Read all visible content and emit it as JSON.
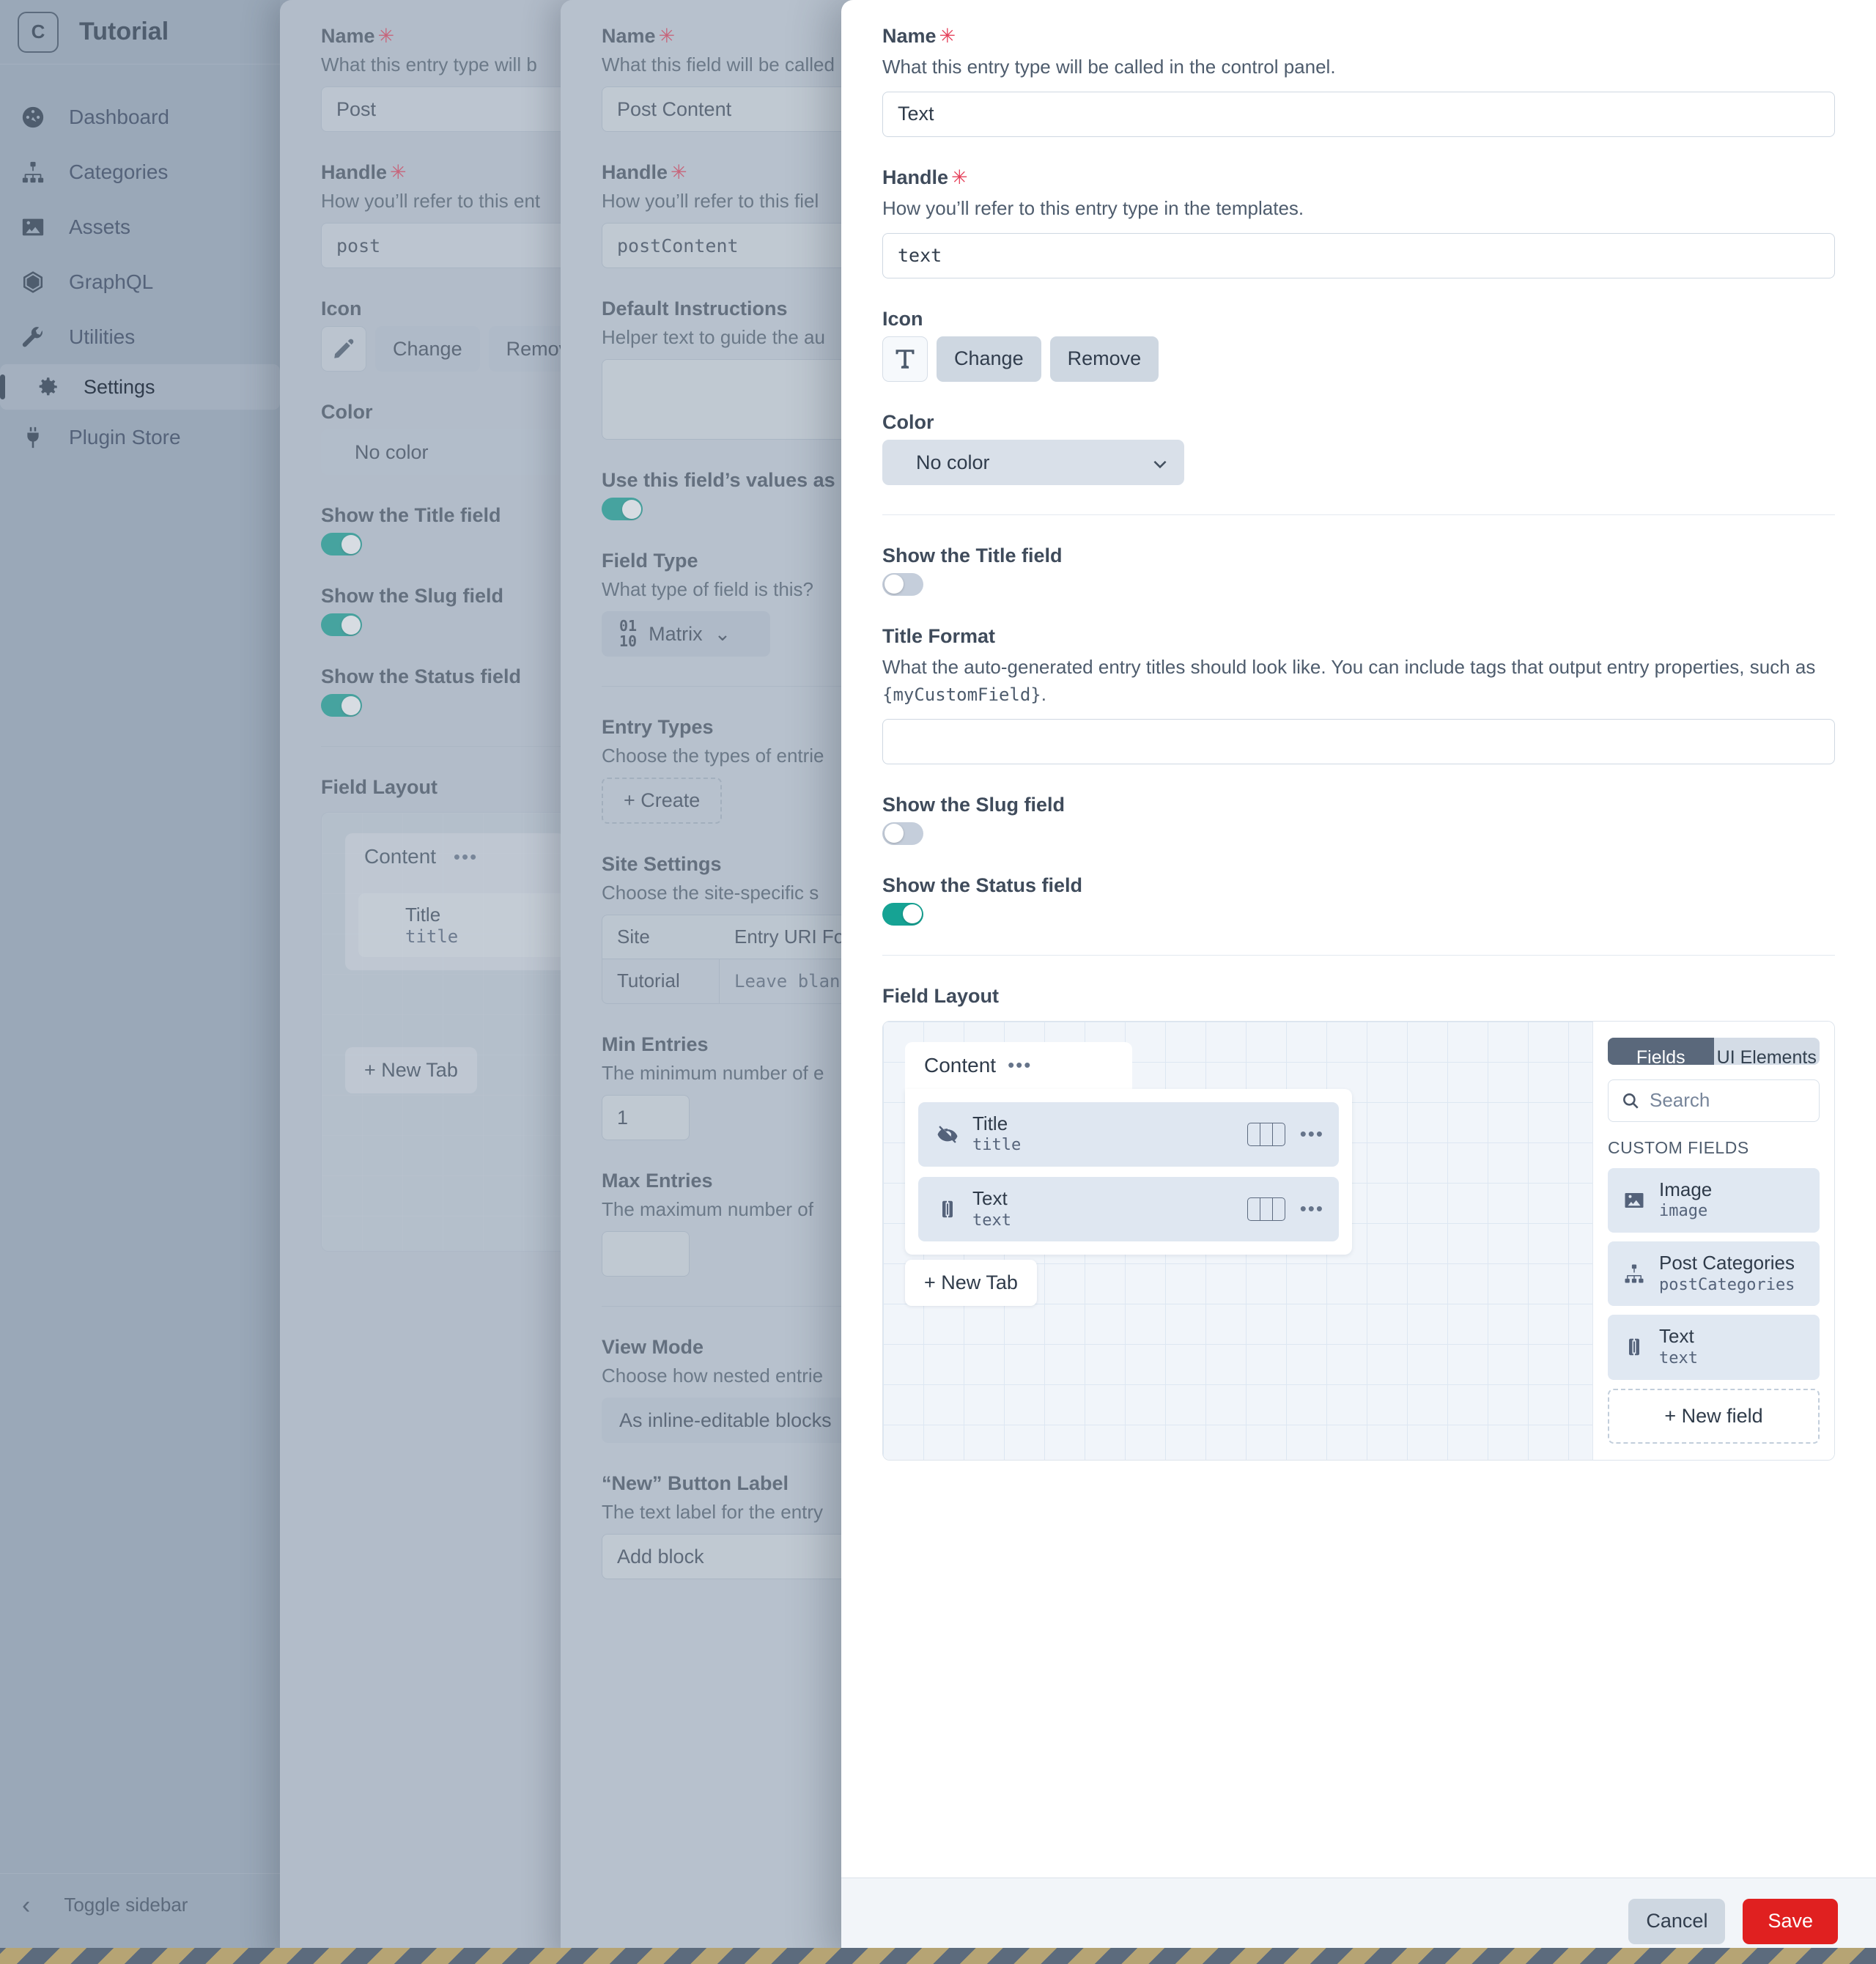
{
  "sidebar": {
    "badge": "C",
    "site_title": "Tutorial",
    "items": [
      {
        "label": "Dashboard",
        "icon": "gauge-icon",
        "selected": false
      },
      {
        "label": "Categories",
        "icon": "sitemap-icon",
        "selected": false
      },
      {
        "label": "Assets",
        "icon": "image-icon",
        "selected": false
      },
      {
        "label": "GraphQL",
        "icon": "graphql-icon",
        "selected": false
      },
      {
        "label": "Utilities",
        "icon": "wrench-icon",
        "selected": false
      },
      {
        "label": "Settings",
        "icon": "gear-icon",
        "selected": true
      },
      {
        "label": "Plugin Store",
        "icon": "plug-icon",
        "selected": false
      }
    ],
    "toggle_sidebar": "Toggle sidebar"
  },
  "entry_type_modal": {
    "name": {
      "label": "Name",
      "required_mark": "✳",
      "instructions": "What this entry type will be called in the control panel.",
      "value": "Text"
    },
    "handle": {
      "label": "Handle",
      "required_mark": "✳",
      "instructions": "How you’ll refer to this entry type in the templates.",
      "value": "text"
    },
    "icon": {
      "label": "Icon",
      "glyph": "text-icon",
      "change_label": "Change",
      "remove_label": "Remove"
    },
    "color": {
      "label": "Color",
      "value": "No color",
      "options": [
        "No color"
      ]
    },
    "show_title": {
      "label": "Show the Title field",
      "on": false
    },
    "title_format": {
      "label": "Title Format",
      "instructions_a": "What the auto-generated entry titles should look like. You can include tags that output entry properties, such as ",
      "instructions_code": "{myCustomField}",
      "instructions_b": ".",
      "value": ""
    },
    "show_slug": {
      "label": "Show the Slug field",
      "on": false
    },
    "show_status": {
      "label": "Show the Status field",
      "on": true
    },
    "field_layout": {
      "label": "Field Layout",
      "tab": {
        "name": "Content",
        "menu": "•••"
      },
      "fields": [
        {
          "name": "Title",
          "handle": "title",
          "icon": "eye-slash-icon",
          "menu": "•••"
        },
        {
          "name": "Text",
          "handle": "text",
          "icon": "text-cursor-icon",
          "menu": "•••"
        }
      ],
      "new_tab_label": "New Tab",
      "library": {
        "tabs": [
          {
            "label": "Fields",
            "active": true
          },
          {
            "label": "UI Elements",
            "active": false
          }
        ],
        "search_placeholder": "Search",
        "search_value": "",
        "group_label": "CUSTOM FIELDS",
        "items": [
          {
            "name": "Image",
            "handle": "image",
            "icon": "image-icon"
          },
          {
            "name": "Post Categories",
            "handle": "postCategories",
            "icon": "sitemap-icon"
          },
          {
            "name": "Text",
            "handle": "text",
            "icon": "text-cursor-icon"
          }
        ],
        "new_field_label": "New field"
      }
    },
    "footer": {
      "cancel": "Cancel",
      "save": "Save"
    }
  },
  "field_modal": {
    "name": {
      "label": "Name",
      "required_mark": "✳",
      "instructions": "What this field will be called",
      "value": "Post Content"
    },
    "handle": {
      "label": "Handle",
      "required_mark": "✳",
      "instructions": "How you’ll refer to this fiel",
      "value": "postContent"
    },
    "default_instructions": {
      "label": "Default Instructions",
      "instructions": "Helper text to guide the au",
      "value": ""
    },
    "use_values_as": {
      "label": "Use this field’s values as",
      "on": true
    },
    "field_type": {
      "label": "Field Type",
      "instructions": "What type of field is this?",
      "value": "Matrix",
      "icon": "binary-icon"
    },
    "entry_types": {
      "label": "Entry Types",
      "instructions": "Choose the types of entrie",
      "create_label": "Create"
    },
    "site_settings": {
      "label": "Site Settings",
      "instructions": "Choose the site-specific s",
      "columns": [
        "Site",
        "Entry URI For"
      ],
      "rows": [
        [
          "Tutorial",
          "Leave blank"
        ]
      ]
    },
    "min_entries": {
      "label": "Min Entries",
      "instructions": "The minimum number of e",
      "value": "1"
    },
    "max_entries": {
      "label": "Max Entries",
      "instructions": "The maximum number of ",
      "value": ""
    },
    "view_mode": {
      "label": "View Mode",
      "instructions": "Choose how nested entrie",
      "value": "As inline-editable blocks"
    },
    "new_button_label": {
      "label": "“New” Button Label",
      "instructions": "The text label for the entry",
      "value": "Add block"
    }
  },
  "post_entry_type_modal": {
    "name": {
      "label": "Name",
      "required_mark": "✳",
      "instructions": "What this entry type will b",
      "value": "Post"
    },
    "handle": {
      "label": "Handle",
      "required_mark": "✳",
      "instructions": "How you’ll refer to this ent",
      "value": "post"
    },
    "icon": {
      "label": "Icon",
      "glyph": "pen-icon",
      "change_label": "Change",
      "remove_label": "Remove"
    },
    "color": {
      "label": "Color",
      "value": "No color"
    },
    "show_title": {
      "label": "Show the Title field",
      "on": true
    },
    "show_slug": {
      "label": "Show the Slug field",
      "on": true
    },
    "show_status": {
      "label": "Show the Status field",
      "on": true
    },
    "field_layout": {
      "label": "Field Layout",
      "tab": {
        "name": "Content",
        "menu": "•••"
      },
      "fields": [
        {
          "name": "Title",
          "handle": "title"
        }
      ],
      "new_tab_label": "New Tab"
    }
  },
  "colors": {
    "accent_toggle_on": "#16a394",
    "save_button": "#e02020",
    "required_mark": "#e5405a",
    "sidebar_bg": "#9aa8b8"
  }
}
